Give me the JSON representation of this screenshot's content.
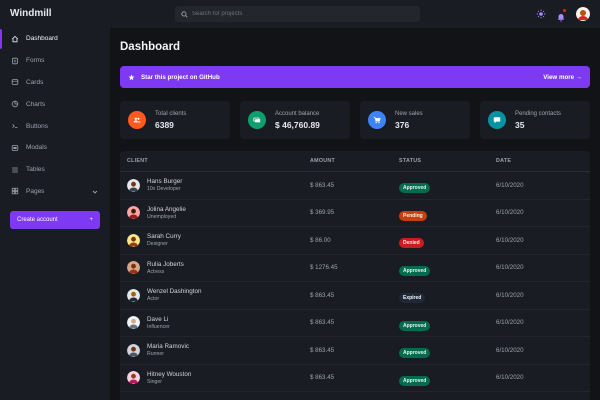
{
  "app": {
    "name": "Windmill"
  },
  "sidebar": {
    "items": [
      {
        "label": "Dashboard",
        "icon": "home-icon"
      },
      {
        "label": "Forms",
        "icon": "forms-icon"
      },
      {
        "label": "Cards",
        "icon": "cards-icon"
      },
      {
        "label": "Charts",
        "icon": "charts-icon"
      },
      {
        "label": "Buttons",
        "icon": "buttons-icon"
      },
      {
        "label": "Modals",
        "icon": "modals-icon"
      },
      {
        "label": "Tables",
        "icon": "tables-icon"
      },
      {
        "label": "Pages",
        "icon": "pages-icon"
      }
    ],
    "create_button": "Create account",
    "create_button_plus": "+"
  },
  "header": {
    "search_placeholder": "Search for projects"
  },
  "main": {
    "title": "Dashboard",
    "banner": {
      "text": "Star this project on GitHub",
      "link": "View more →"
    },
    "cards": [
      {
        "label": "Total clients",
        "value": "6389",
        "color": "#ff5a1f"
      },
      {
        "label": "Account balance",
        "value": "$ 46,760.89",
        "color": "#0e9f6e"
      },
      {
        "label": "New sales",
        "value": "376",
        "color": "#3f83f8"
      },
      {
        "label": "Pending contacts",
        "value": "35",
        "color": "#0694a2"
      }
    ],
    "table": {
      "headers": [
        "CLIENT",
        "AMOUNT",
        "STATUS",
        "DATE"
      ],
      "rows": [
        {
          "name": "Hans Burger",
          "role": "10x Developer",
          "amount": "$ 863.45",
          "status": "Approved",
          "date": "6/10/2020"
        },
        {
          "name": "Jolina Angelie",
          "role": "Unemployed",
          "amount": "$ 369.95",
          "status": "Pending",
          "date": "6/10/2020"
        },
        {
          "name": "Sarah Curry",
          "role": "Designer",
          "amount": "$ 86.00",
          "status": "Denied",
          "date": "6/10/2020"
        },
        {
          "name": "Rulia Joberts",
          "role": "Actress",
          "amount": "$ 1276.45",
          "status": "Approved",
          "date": "6/10/2020"
        },
        {
          "name": "Wenzel Dashington",
          "role": "Actor",
          "amount": "$ 863.45",
          "status": "Expired",
          "date": "6/10/2020"
        },
        {
          "name": "Dave Li",
          "role": "Influencer",
          "amount": "$ 863.45",
          "status": "Approved",
          "date": "6/10/2020"
        },
        {
          "name": "Maria Ramovic",
          "role": "Runner",
          "amount": "$ 863.45",
          "status": "Approved",
          "date": "6/10/2020"
        },
        {
          "name": "Hitney Wouston",
          "role": "Singer",
          "amount": "$ 863.45",
          "status": "Approved",
          "date": "6/10/2020"
        }
      ]
    }
  },
  "colors": {
    "accent": "#7e3af2",
    "background": "#121317",
    "panel": "#1a1c23"
  }
}
